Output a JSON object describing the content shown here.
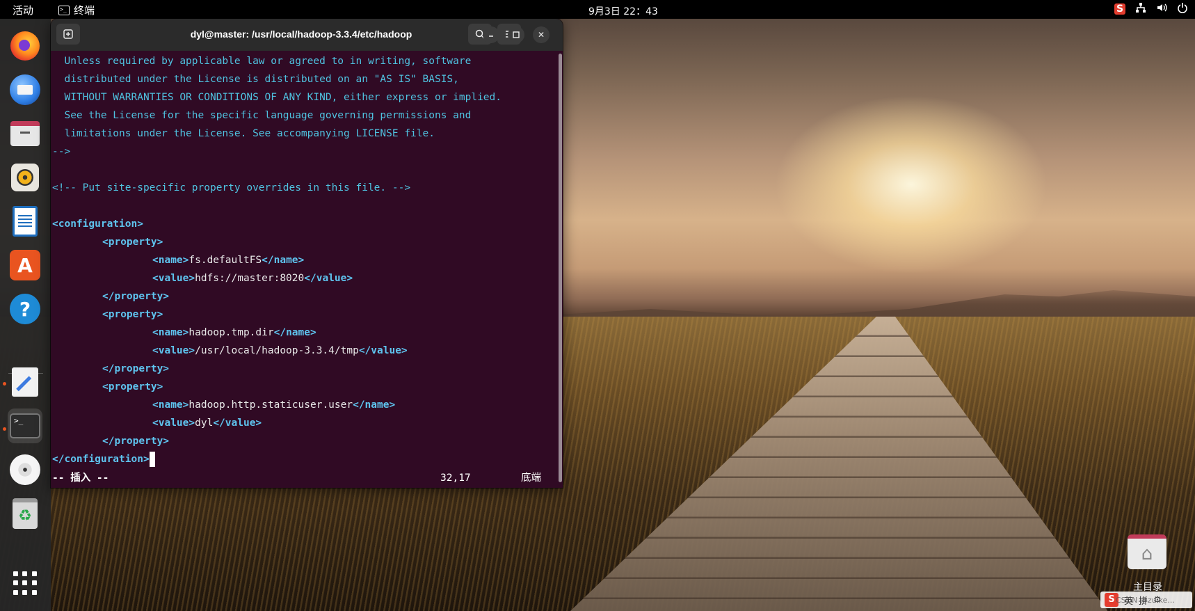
{
  "topbar": {
    "activities": "活动",
    "app_name": "终端",
    "clock": "9月3日  22：43",
    "tray": {
      "ime_icon": "sogou-icon",
      "network_icon": "network-icon",
      "volume_icon": "volume-icon",
      "power_icon": "power-icon"
    }
  },
  "dock": {
    "items": [
      "firefox",
      "thunderbird",
      "files",
      "rhythmbox",
      "libreoffice-writer",
      "app-store",
      "help",
      "text-editor",
      "terminal",
      "dvd-drive",
      "trash",
      "show-applications"
    ],
    "running": [
      "text-editor",
      "terminal"
    ]
  },
  "terminal": {
    "title": "dyl@master: /usr/local/hadoop-3.3.4/etc/hadoop",
    "lines": {
      "l1": "  Unless required by applicable law or agreed to in writing, software",
      "l2": "  distributed under the License is distributed on an \"AS IS\" BASIS,",
      "l3": "  WITHOUT WARRANTIES OR CONDITIONS OF ANY KIND, either express or implied.",
      "l4": "  See the License for the specific language governing permissions and",
      "l5": "  limitations under the License. See accompanying LICENSE file.",
      "l6": "-->",
      "l7": "<!-- Put site-specific property overrides in this file. -->",
      "config_open": "<configuration>",
      "prop_open": "<property>",
      "prop_close": "</property>",
      "name_open": "<name>",
      "name_close": "</name>",
      "value_open": "<value>",
      "value_close": "</value>",
      "config_close": "</configuration>"
    },
    "properties": [
      {
        "name": "fs.defaultFS",
        "value": "hdfs://master:8020"
      },
      {
        "name": "hadoop.tmp.dir",
        "value": "/usr/local/hadoop-3.3.4/tmp"
      },
      {
        "name": "hadoop.http.staticuser.user",
        "value": "dyl"
      }
    ],
    "status": {
      "mode": "-- 插入 --",
      "position": "32,17",
      "scroll": "底端"
    }
  },
  "desktop": {
    "home_label": "主目录"
  },
  "ime": {
    "lang": "英",
    "mode": "拼",
    "watermark": "CSDN @zuike..."
  },
  "colors": {
    "terminal_bg": "#300a24",
    "terminal_text": "#4fc2e0",
    "tag_color": "#5ec3ee",
    "accent": "#e95420"
  }
}
